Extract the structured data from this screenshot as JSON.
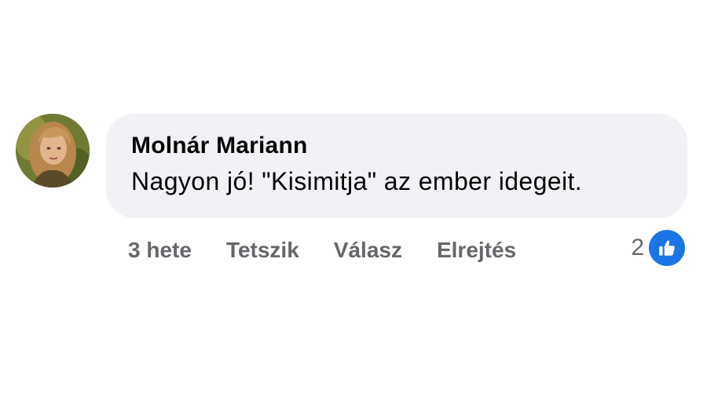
{
  "comment": {
    "author": "Molnár Mariann",
    "text": "Nagyon jó! \"Kisimitja\" az ember idegeit."
  },
  "actions": {
    "timestamp": "3 hete",
    "like_label": "Tetszik",
    "reply_label": "Válasz",
    "hide_label": "Elrejtés"
  },
  "reactions": {
    "count": "2",
    "icon": "thumbs-up-icon",
    "badge_color": "#1b74e4"
  },
  "colors": {
    "bubble": "#f0f2f5",
    "text": "#050505",
    "secondary": "#65676b"
  }
}
